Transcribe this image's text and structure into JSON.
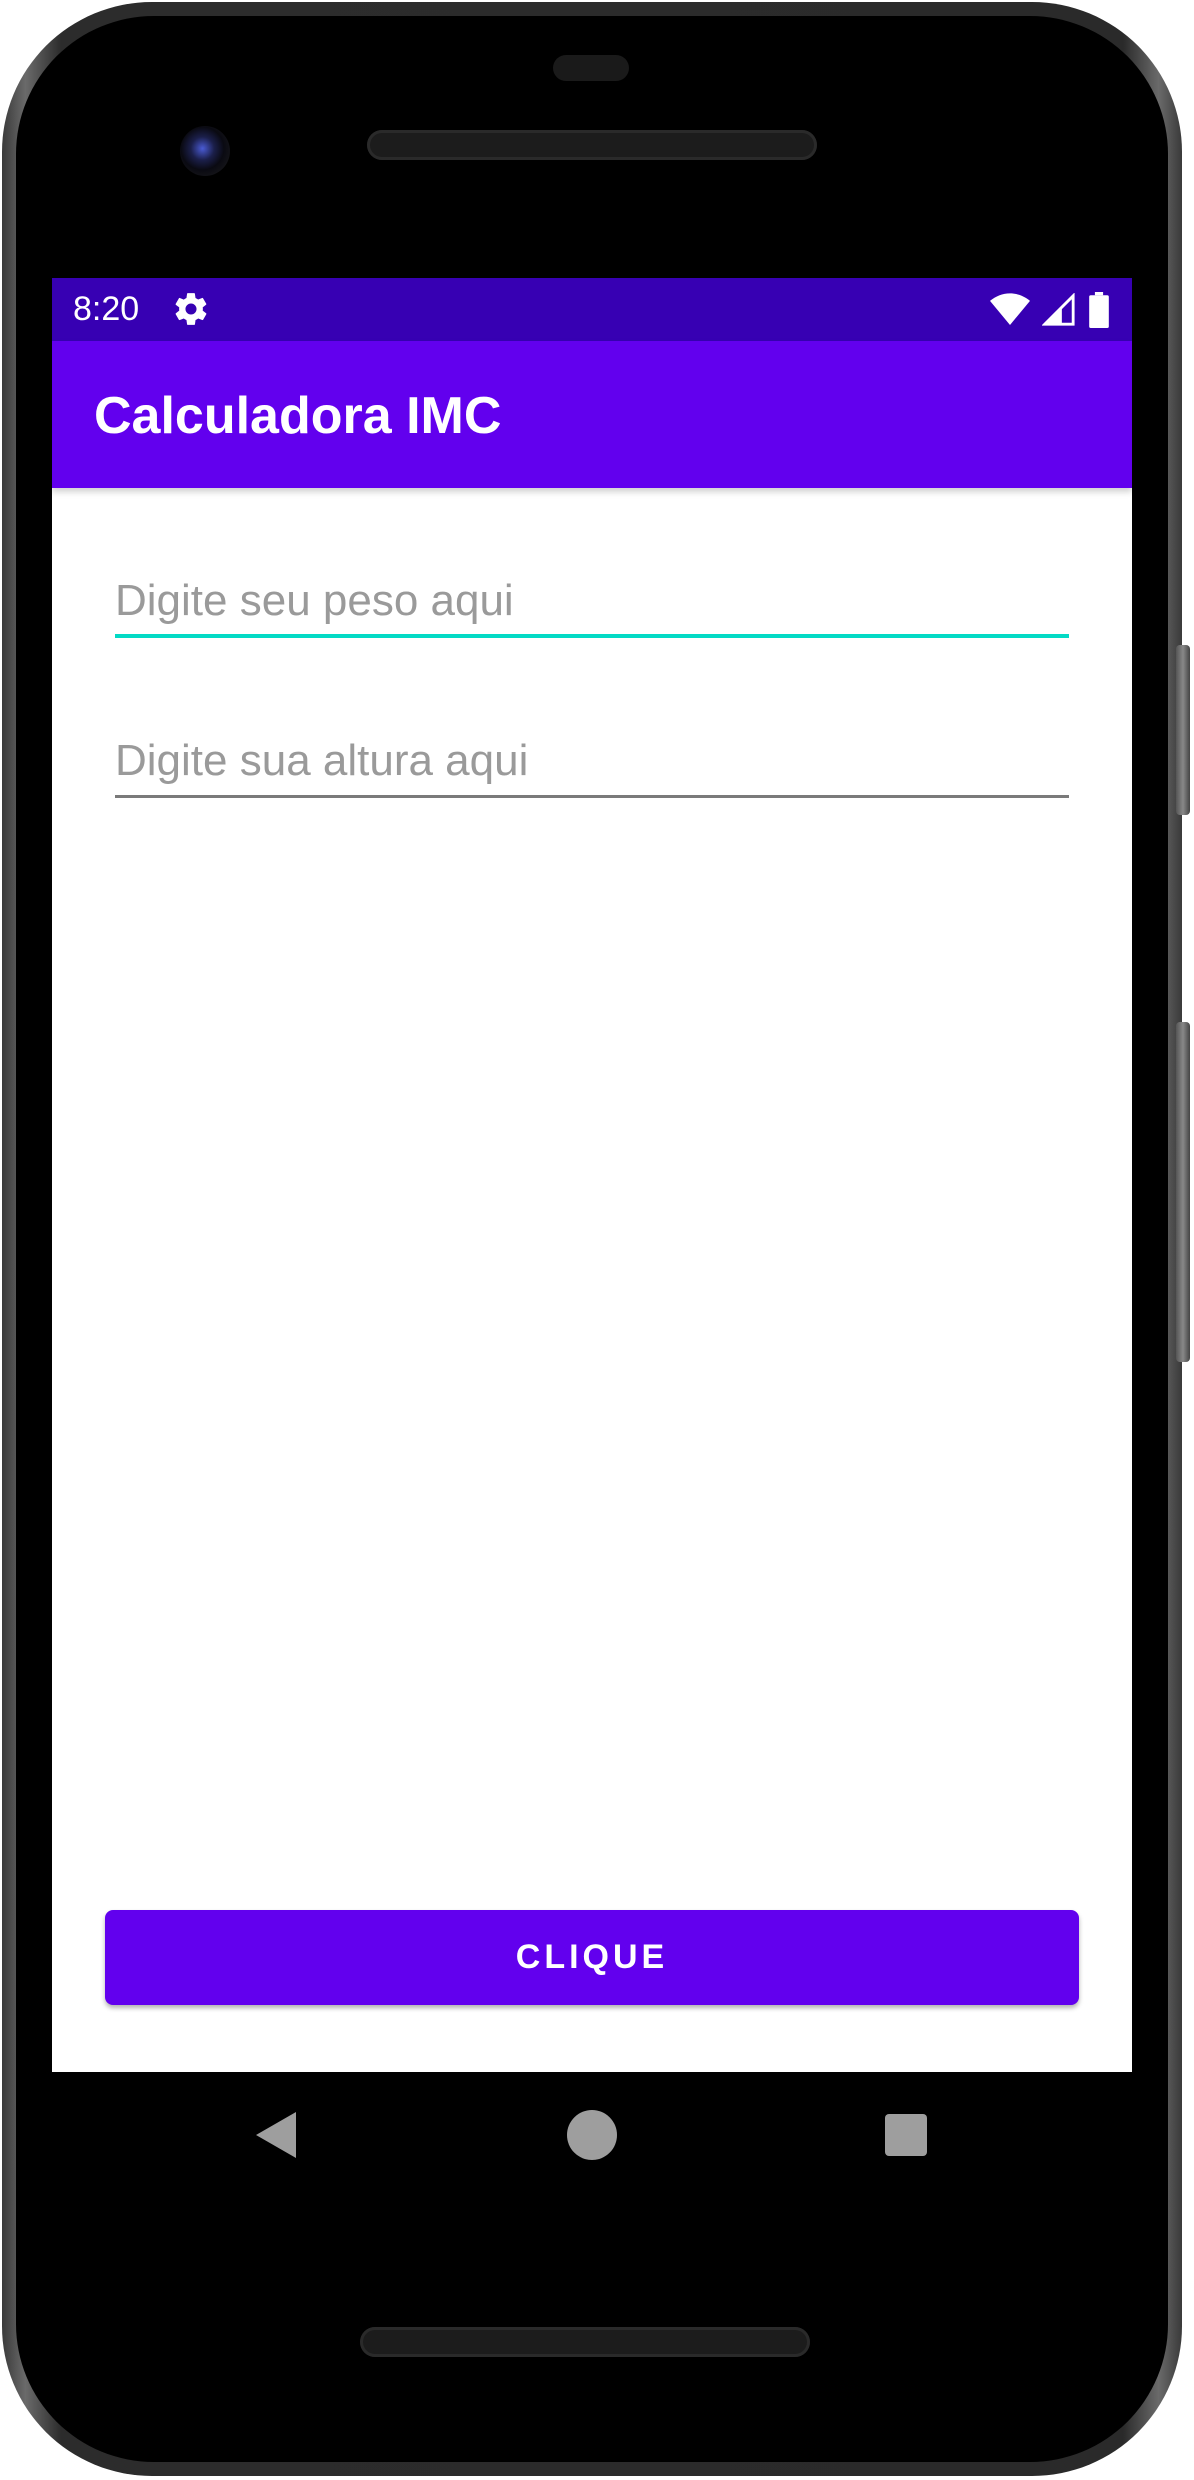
{
  "status_bar": {
    "time": "8:20",
    "icons": [
      "gear-icon",
      "wifi-icon",
      "cell-signal-icon",
      "battery-icon"
    ]
  },
  "app_bar": {
    "title": "Calculadora IMC"
  },
  "form": {
    "weight": {
      "placeholder": "Digite seu peso aqui",
      "value": ""
    },
    "height": {
      "placeholder": "Digite sua altura aqui",
      "value": ""
    }
  },
  "button": {
    "label": "CLIQUE"
  },
  "nav_bar": {
    "items": [
      "back-icon",
      "home-icon",
      "recents-icon"
    ]
  },
  "colors": {
    "primary": "#6200ee",
    "primary_dark": "#3700b3",
    "accent": "#03dac5"
  }
}
